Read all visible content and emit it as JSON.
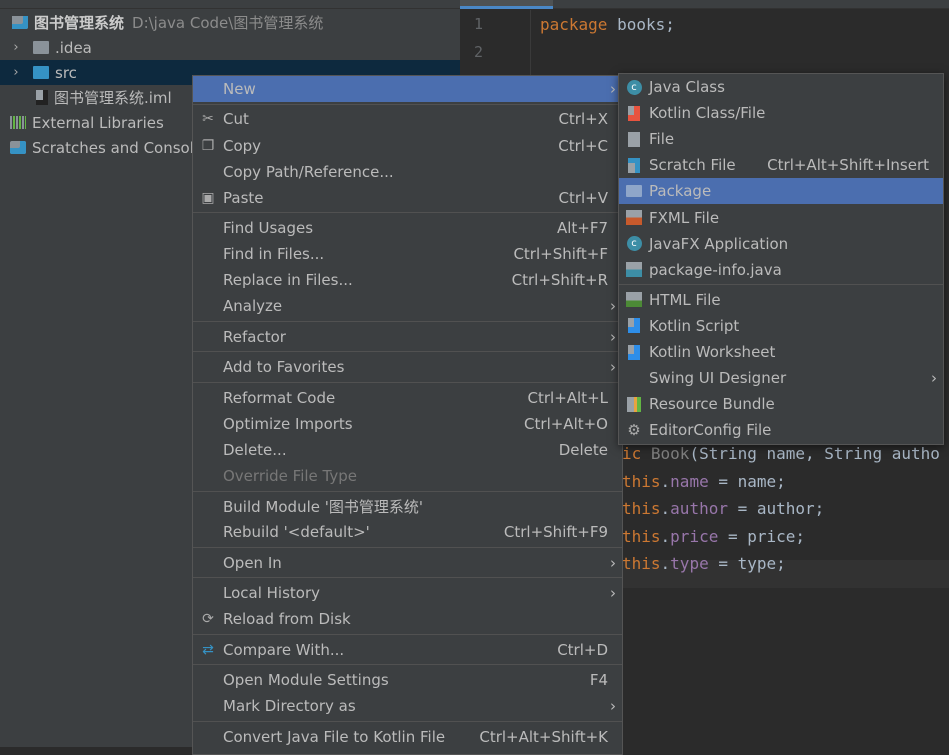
{
  "project_tree": {
    "root": {
      "name": "图书管理系统",
      "path": "D:\\java Code\\图书管理系统"
    },
    "items": [
      {
        "label": ".idea",
        "icon": "folder-icon",
        "expandable": true
      },
      {
        "label": "src",
        "icon": "source-folder-icon",
        "expandable": true,
        "selected": true
      },
      {
        "label": "图书管理系统.iml",
        "icon": "module-file-icon"
      },
      {
        "label": "External Libraries",
        "icon": "libraries-icon"
      },
      {
        "label": "Scratches and Consoles",
        "icon": "scratches-icon"
      }
    ]
  },
  "editor": {
    "line_numbers": [
      "1",
      "2"
    ],
    "line1": {
      "kw": "package",
      "rest": " books;"
    },
    "lines": [
      {
        "a": "ic ",
        "b": "Book",
        "c": "(String name, String autho"
      },
      {
        "this": "this",
        "f": "name",
        "rest": " = name;"
      },
      {
        "this": "this",
        "f": "author",
        "rest": " = author;"
      },
      {
        "this": "this",
        "f": "price",
        "rest": " = price;"
      },
      {
        "this": "this",
        "f": "type",
        "rest": " = type;"
      }
    ]
  },
  "context_menu": {
    "items": [
      {
        "label": "New",
        "submenu": true,
        "highlighted": true
      },
      {
        "sep": true
      },
      {
        "label": "Cut",
        "shortcut": "Ctrl+X",
        "icon": "scissors-icon"
      },
      {
        "label": "Copy",
        "shortcut": "Ctrl+C",
        "icon": "copy-icon"
      },
      {
        "label": "Copy Path/Reference..."
      },
      {
        "label": "Paste",
        "shortcut": "Ctrl+V",
        "icon": "clipboard-icon"
      },
      {
        "sep": true
      },
      {
        "label": "Find Usages",
        "shortcut": "Alt+F7"
      },
      {
        "label": "Find in Files...",
        "shortcut": "Ctrl+Shift+F"
      },
      {
        "label": "Replace in Files...",
        "shortcut": "Ctrl+Shift+R"
      },
      {
        "label": "Analyze",
        "submenu": true
      },
      {
        "sep": true
      },
      {
        "label": "Refactor",
        "submenu": true
      },
      {
        "sep": true
      },
      {
        "label": "Add to Favorites",
        "submenu": true
      },
      {
        "sep": true
      },
      {
        "label": "Reformat Code",
        "shortcut": "Ctrl+Alt+L"
      },
      {
        "label": "Optimize Imports",
        "shortcut": "Ctrl+Alt+O"
      },
      {
        "label": "Delete...",
        "shortcut": "Delete"
      },
      {
        "label": "Override File Type",
        "disabled": true
      },
      {
        "sep": true
      },
      {
        "label": "Build Module '图书管理系统'"
      },
      {
        "label": "Rebuild '<default>'",
        "shortcut": "Ctrl+Shift+F9"
      },
      {
        "sep": true
      },
      {
        "label": "Open In",
        "submenu": true
      },
      {
        "sep": true
      },
      {
        "label": "Local History",
        "submenu": true
      },
      {
        "label": "Reload from Disk",
        "icon": "reload-icon"
      },
      {
        "sep": true
      },
      {
        "label": "Compare With...",
        "shortcut": "Ctrl+D",
        "icon": "compare-icon"
      },
      {
        "sep": true
      },
      {
        "label": "Open Module Settings",
        "shortcut": "F4"
      },
      {
        "label": "Mark Directory as",
        "submenu": true
      },
      {
        "sep": true
      },
      {
        "label": "Convert Java File to Kotlin File",
        "shortcut": "Ctrl+Alt+Shift+K"
      }
    ]
  },
  "new_submenu": {
    "items": [
      {
        "label": "Java Class",
        "icon": "java-class-icon"
      },
      {
        "label": "Kotlin Class/File",
        "icon": "kotlin-file-icon"
      },
      {
        "label": "File",
        "icon": "file-icon"
      },
      {
        "label": "Scratch File",
        "shortcut": "Ctrl+Alt+Shift+Insert",
        "icon": "scratch-file-icon"
      },
      {
        "label": "Package",
        "icon": "package-icon",
        "highlighted": true
      },
      {
        "label": "FXML File",
        "icon": "fxml-file-icon"
      },
      {
        "label": "JavaFX Application",
        "icon": "javafx-class-icon"
      },
      {
        "label": "package-info.java",
        "icon": "package-info-icon"
      },
      {
        "sep": true
      },
      {
        "label": "HTML File",
        "icon": "html-file-icon"
      },
      {
        "label": "Kotlin Script",
        "icon": "kotlin-script-icon"
      },
      {
        "label": "Kotlin Worksheet",
        "icon": "kotlin-worksheet-icon"
      },
      {
        "label": "Swing UI Designer",
        "submenu": true
      },
      {
        "label": "Resource Bundle",
        "icon": "resource-bundle-icon"
      },
      {
        "label": "EditorConfig File",
        "icon": "gear-icon"
      }
    ]
  },
  "colors": {
    "selection": "#4b6eaf",
    "menu_bg": "#3c3f41",
    "keyword": "#cc7832",
    "field": "#9876aa",
    "tree_selection": "#0d293e"
  }
}
